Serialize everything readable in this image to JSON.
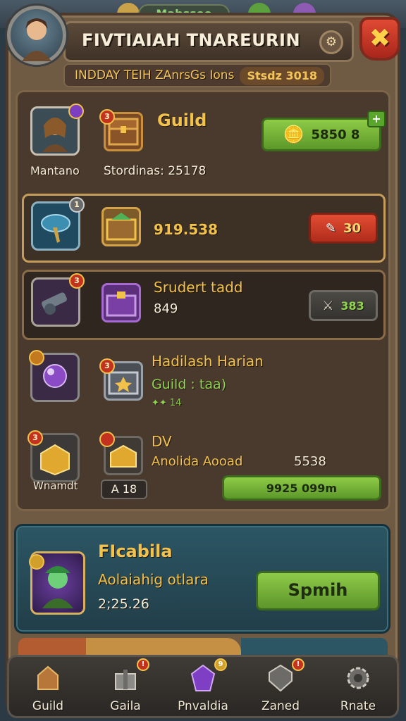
{
  "header": {
    "title": "FIVTIAIAH TNAREURIN",
    "subtitle": "INDDAY TEIH ZAnrsGs Ions",
    "subtitle_value": "Stsdz 3018",
    "settings_glyph": "⚙",
    "close_glyph": "✖",
    "top_chip": "Mabssoo"
  },
  "rows": [
    {
      "icon_label": "Mantano",
      "title": "Guild",
      "subtitle": "Stordinas: 25178",
      "button_value": "5850 8",
      "badge": "3"
    },
    {
      "value": "919.538",
      "button_value": "30",
      "badge": "1"
    },
    {
      "title": "Srudert tadd",
      "subtitle": "849",
      "button_value": "383",
      "badge": "3"
    },
    {
      "title": "Hadilash Harian",
      "subtitle": "Guild : taa)",
      "tag": "✦✦ 14",
      "badge": "3"
    },
    {
      "icon_label": "Wnamdt",
      "chest_label": "A 18",
      "title": "DV",
      "subtitle": "Anolida Aooad",
      "value": "5538",
      "button_value": "9925 099m",
      "badge": "3"
    }
  ],
  "promo": {
    "title": "FIcabila",
    "subtitle": "Aolaiahig otlara",
    "value": "2;25.26",
    "button_label": "Spmih"
  },
  "nav": [
    {
      "label": "Guild",
      "icon": "guild-icon"
    },
    {
      "label": "Gaila",
      "icon": "gift-icon",
      "badge": "!"
    },
    {
      "label": "Pnvaldia",
      "icon": "crystal-icon",
      "badge": "9"
    },
    {
      "label": "Zaned",
      "icon": "shield-icon",
      "badge": "!"
    },
    {
      "label": "Rnate",
      "icon": "gear-icon"
    }
  ],
  "colors": {
    "accent_gold": "#f3c24a",
    "accent_green": "#8fd34f",
    "close_red": "#c3321f",
    "promo_teal": "#2c5664"
  }
}
